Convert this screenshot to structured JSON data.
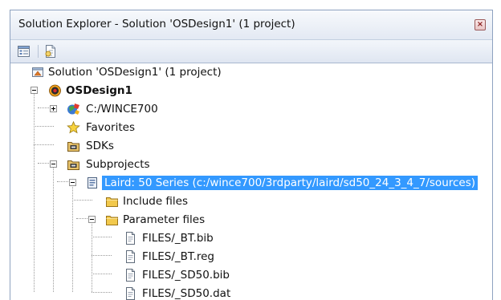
{
  "window": {
    "title": "Solution Explorer - Solution 'OSDesign1' (1 project)",
    "close_glyph": "×"
  },
  "toolbar": {
    "buttons": [
      {
        "icon": "properties-icon"
      },
      {
        "icon": "show-all-files-icon"
      }
    ]
  },
  "tree": {
    "solution": "Solution 'OSDesign1' (1 project)",
    "osdesign": "OSDesign1",
    "wince": "C:/WINCE700",
    "favorites": "Favorites",
    "sdks": "SDKs",
    "subprojects": "Subprojects",
    "laird": "Laird: 50 Series (c:/wince700/3rdparty/laird/sd50_24_3_4_7/sources)",
    "include_files": "Include files",
    "parameter_files": "Parameter files",
    "file1": "FILES/_BT.bib",
    "file2": "FILES/_BT.reg",
    "file3": "FILES/_SD50.bib",
    "file4": "FILES/_SD50.dat"
  },
  "colors": {
    "selection": "#3399ff",
    "folder": "#f2c94c",
    "border": "#8ea2c0"
  }
}
